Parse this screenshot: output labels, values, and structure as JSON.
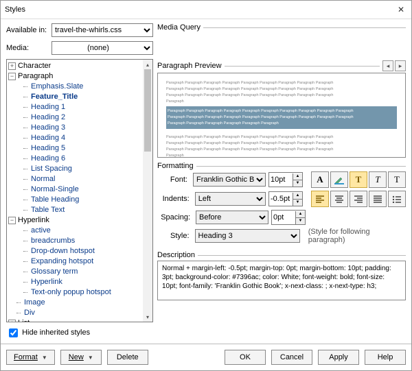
{
  "title": "Styles",
  "labels": {
    "available_in": "Available in:",
    "media": "Media:",
    "hide_inherited": "Hide inherited styles"
  },
  "available_in_value": "travel-the-whirls.css",
  "media_value": "(none)",
  "tree": {
    "characters": "Character",
    "paragraph": "Paragraph",
    "paragraph_children": [
      "Emphasis.Slate",
      "Feature_Title",
      "Heading 1",
      "Heading 2",
      "Heading 3",
      "Heading 4",
      "Heading 5",
      "Heading 6",
      "List Spacing",
      "Normal",
      "Normal-Single",
      "Table Heading",
      "Table Text"
    ],
    "hyperlink": "Hyperlink",
    "hyperlink_children": [
      "active",
      "breadcrumbs",
      "Drop-down hotspot",
      "Expanding hotspot",
      "Glossary term",
      "Hyperlink",
      "Text-only popup hotspot"
    ],
    "image": "Image",
    "div": "Div",
    "list": "List",
    "selected_index": 1
  },
  "sections": {
    "media_query": "Media Query",
    "paragraph_preview": "Paragraph Preview",
    "formatting": "Formatting",
    "description": "Description"
  },
  "preview": {
    "word": "Paragraph"
  },
  "formatting": {
    "font_label": "Font:",
    "font_family": "Franklin Gothic B",
    "font_size": "10pt",
    "indents_label": "Indents:",
    "indents_side": "Left",
    "indents_value": "-0.5pt",
    "spacing_label": "Spacing:",
    "spacing_side": "Before",
    "spacing_value": "0pt",
    "style_label": "Style:",
    "style_value": "Heading 3",
    "style_note": "(Style for following paragraph)"
  },
  "description_text": "Normal + margin-left: -0.5pt;  margin-top: 0pt;  margin-bottom: 10pt;  padding: 3pt;  background-color: #7396ac;  color: White;  font-weight: bold;  font-size: 10pt;  font-family: 'Franklin Gothic Book';  x-next-class: ;  x-next-type: h3;",
  "footer": {
    "format": "Format",
    "new": "New",
    "delete": "Delete",
    "ok": "OK",
    "cancel": "Cancel",
    "apply": "Apply",
    "help": "Help"
  }
}
